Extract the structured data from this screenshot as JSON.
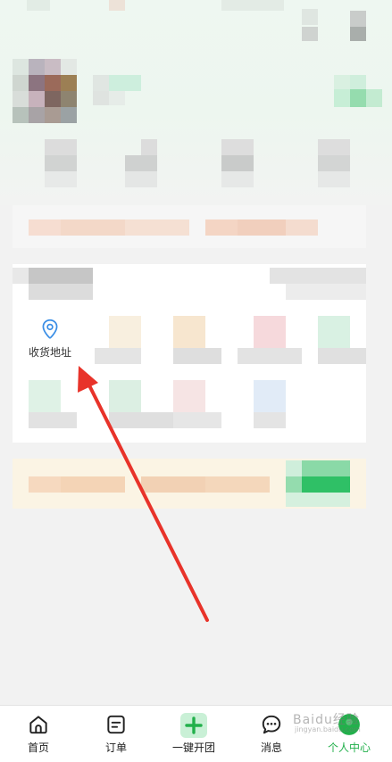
{
  "address_shortcut": {
    "label": "收货地址",
    "icon": "location-pin-icon"
  },
  "tabbar": {
    "items": [
      {
        "label": "首页",
        "icon": "home-icon"
      },
      {
        "label": "订单",
        "icon": "order-icon"
      },
      {
        "label": "一键开团",
        "icon": "plus-icon"
      },
      {
        "label": "消息",
        "icon": "chat-icon"
      },
      {
        "label": "个人中心",
        "icon": "profile-icon"
      }
    ],
    "active_index": 4
  },
  "watermark": {
    "line1": "Baidu经验",
    "line2": "jingyan.baidu.com"
  },
  "colors": {
    "accent": "#22b04b",
    "annotation_arrow": "#e8332a",
    "address_icon": "#3a8ee6"
  }
}
